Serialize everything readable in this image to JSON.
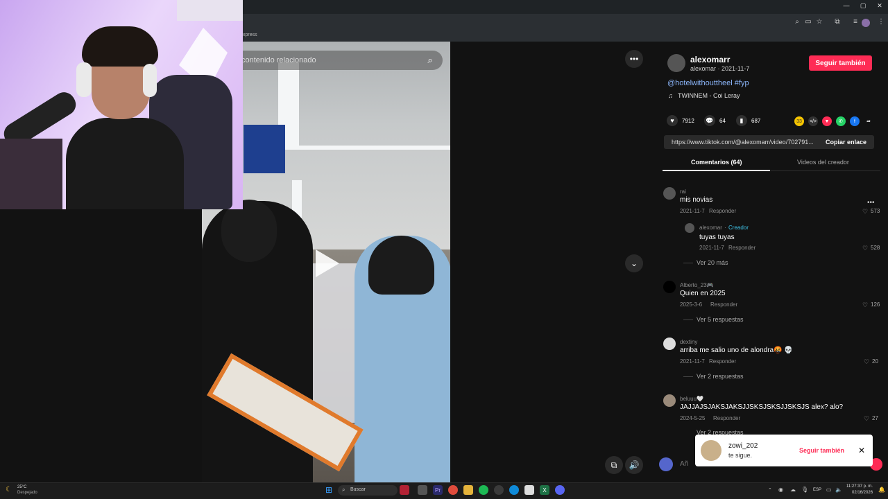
{
  "browser": {
    "bookmark_label": "xpress",
    "window_controls": [
      "—",
      "▢",
      "✕"
    ]
  },
  "video": {
    "search_placeholder": "contenido relacionado",
    "more_label": "•••",
    "down_label": "⌄",
    "mute_label": "🔊",
    "mini_label": "⧉"
  },
  "post": {
    "username": "alexomarr",
    "subline": "alexomar · 2021-11-7",
    "follow_label": "Seguir también",
    "caption": "@hotelwithouttheel #fyp",
    "music": "TWINNEM - Coi Leray",
    "likes": "7912",
    "comments_count": "64",
    "saves": "687",
    "link": "https://www.tiktok.com/@alexomarr/video/702791...",
    "copy_label": "Copiar enlace",
    "share_badge": "33"
  },
  "tabs": [
    {
      "label": "Comentarios (64)"
    },
    {
      "label": "Videos del creador"
    }
  ],
  "comments": [
    {
      "user": "rai",
      "text": "mis novias",
      "date": "2021-11-7",
      "reply": "Responder",
      "likes": "573"
    },
    {
      "user": "alexomar",
      "creator": "Creador",
      "text": "tuyas tuyas",
      "date": "2021-11-7",
      "reply": "Responder",
      "likes": "528"
    },
    {
      "more": "Ver 20 más"
    },
    {
      "user": "Alberto_23🎮",
      "text": "Quien en 2025",
      "date": "2025-3-6",
      "reply": "Responder",
      "likes": "126",
      "more": "Ver 5 respuestas"
    },
    {
      "user": "dextiny",
      "text": "arriba me salio uno de alondra🤬 💀",
      "date": "2021-11-7",
      "reply": "Responder",
      "likes": "20",
      "more": "Ver 2 respuestas"
    },
    {
      "user": "beluuu🤍",
      "text": "JAJJAJSJAKSJAKSJJSKSJSKSJJSKSJS alex? alo?",
      "date": "2024-5-25",
      "reply": "Responder",
      "likes": "27",
      "more": "Ver 2 respuestas"
    }
  ],
  "comment_input": {
    "placeholder": "Añ"
  },
  "notification": {
    "user": "zowi_202",
    "text": "te sigue.",
    "follow_label": "Seguir también"
  },
  "taskbar": {
    "weather_temp": "25°C",
    "weather_desc": "Despejado",
    "search_label": "Buscar",
    "lang": "ESP",
    "time": "11:27:37 p. m.",
    "date": "02/16/2026"
  },
  "colors": {
    "accent": "#fe2c55",
    "link": "#8ab4f8",
    "creator": "#3fc3e8"
  }
}
